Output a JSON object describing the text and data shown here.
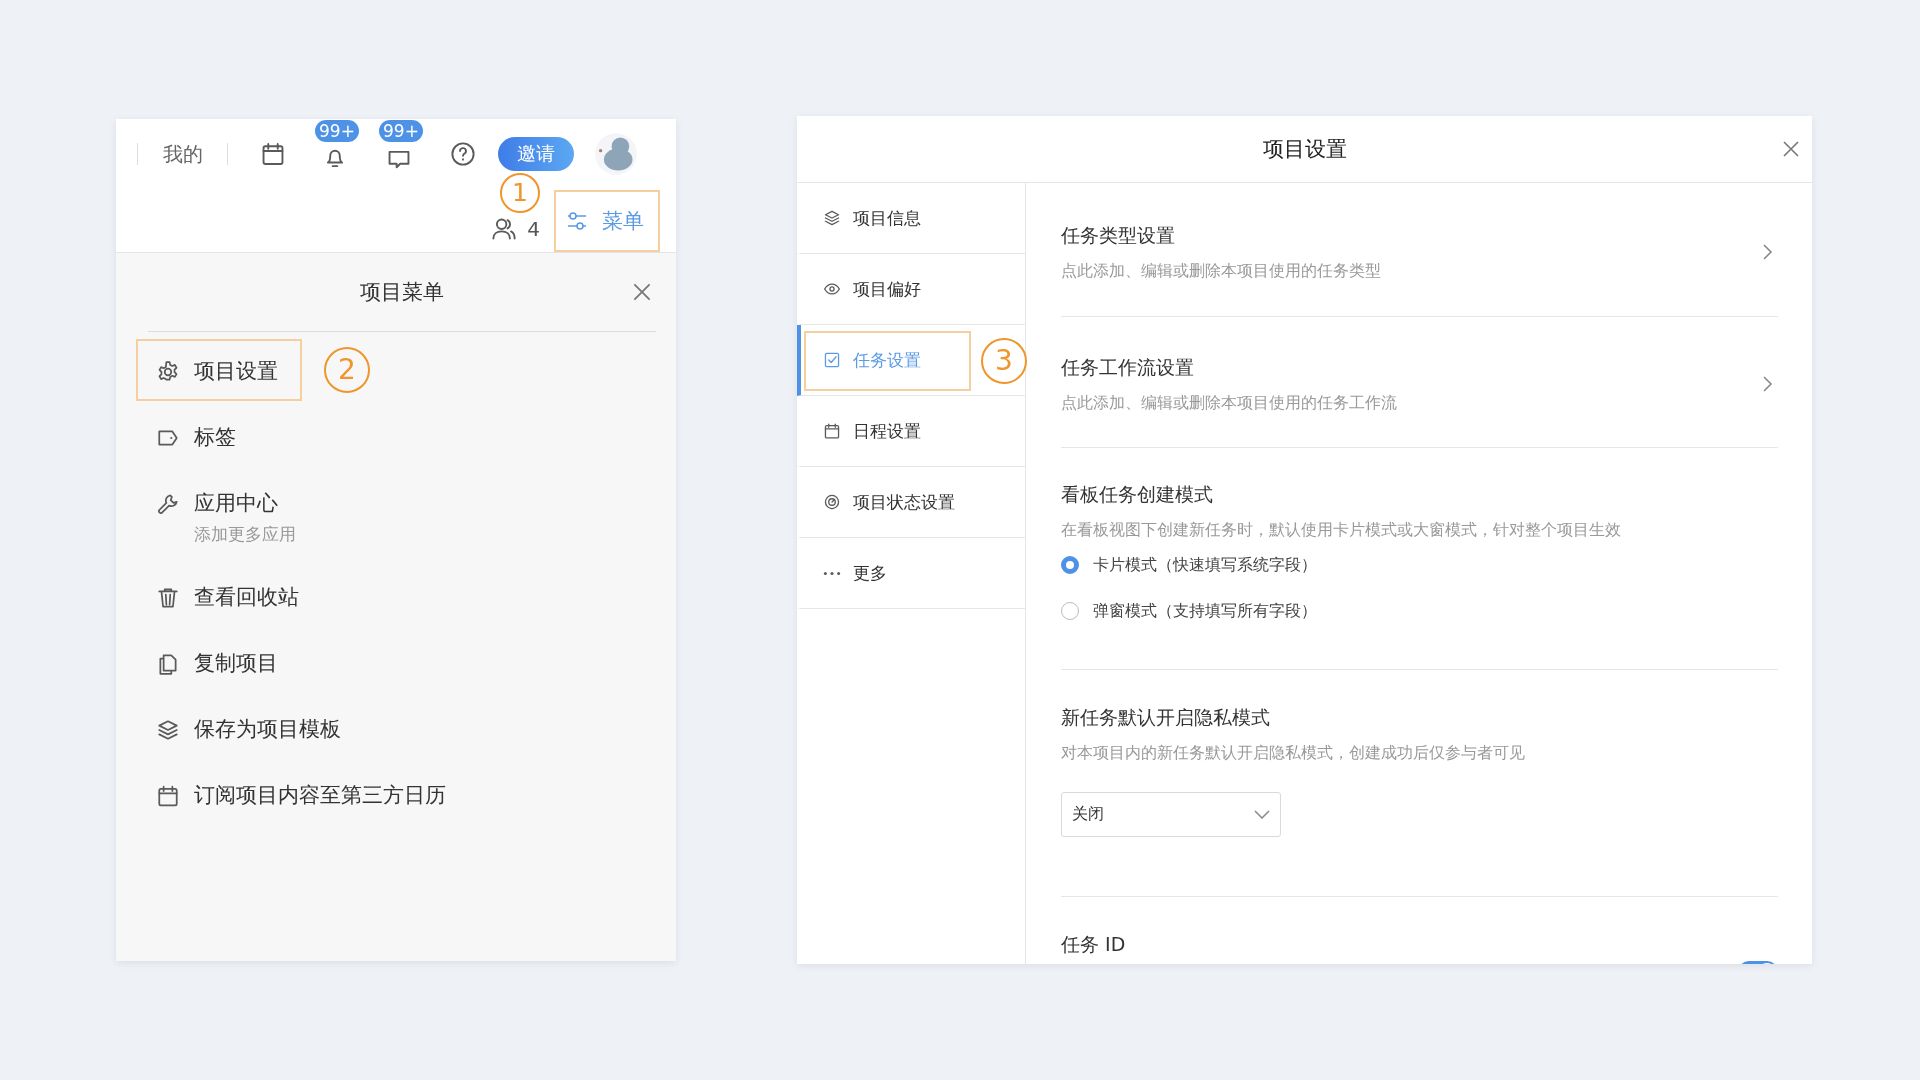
{
  "top_bar": {
    "my_tab": "我的",
    "badges": [
      "99+",
      "99+"
    ],
    "invite_button": "邀请"
  },
  "project_bar": {
    "member_count": "4",
    "menu_button": {
      "label": "菜单",
      "highlighted": true,
      "annotation": "1"
    }
  },
  "project_menu": {
    "title": "项目菜单",
    "items": [
      {
        "label": "项目设置",
        "highlighted": true,
        "annotation": "2"
      },
      {
        "label": "标签",
        "highlighted": false
      },
      {
        "label": "应用中心",
        "subtitle": "添加更多应用",
        "highlighted": false
      },
      {
        "label": "查看回收站",
        "highlighted": false
      },
      {
        "label": "复制项目",
        "highlighted": false
      },
      {
        "label": "保存为项目模板",
        "highlighted": false
      },
      {
        "label": "订阅项目内容至第三方日历",
        "highlighted": false
      }
    ]
  },
  "settings_dialog": {
    "title": "项目设置",
    "nav": [
      {
        "label": "项目信息",
        "selected": false,
        "highlighted": false
      },
      {
        "label": "项目偏好",
        "selected": false,
        "highlighted": false
      },
      {
        "label": "任务设置",
        "selected": true,
        "highlighted": true,
        "annotation": "3"
      },
      {
        "label": "日程设置",
        "selected": false,
        "highlighted": false
      },
      {
        "label": "项目状态设置",
        "selected": false,
        "highlighted": false
      },
      {
        "label": "更多",
        "selected": false,
        "highlighted": false
      }
    ],
    "sections": [
      {
        "kind": "link",
        "title": "任务类型设置",
        "description": "点此添加、编辑或删除本项目使用的任务类型"
      },
      {
        "kind": "link",
        "title": "任务工作流设置",
        "description": "点此添加、编辑或删除本项目使用的任务工作流"
      },
      {
        "kind": "radio",
        "title": "看板任务创建模式",
        "description": "在看板视图下创建新任务时，默认使用卡片模式或大窗模式，针对整个项目生效",
        "options": [
          {
            "label": "卡片模式（快速填写系统字段）",
            "selected": true
          },
          {
            "label": "弹窗模式（支持填写所有字段）",
            "selected": false
          }
        ]
      },
      {
        "kind": "select",
        "title": "新任务默认开启隐私模式",
        "description": "对本项目内的新任务默认开启隐私模式，创建成功后仅参与者可见",
        "value": "关闭"
      },
      {
        "kind": "toggle",
        "title": "任务 ID",
        "on": true
      }
    ]
  }
}
